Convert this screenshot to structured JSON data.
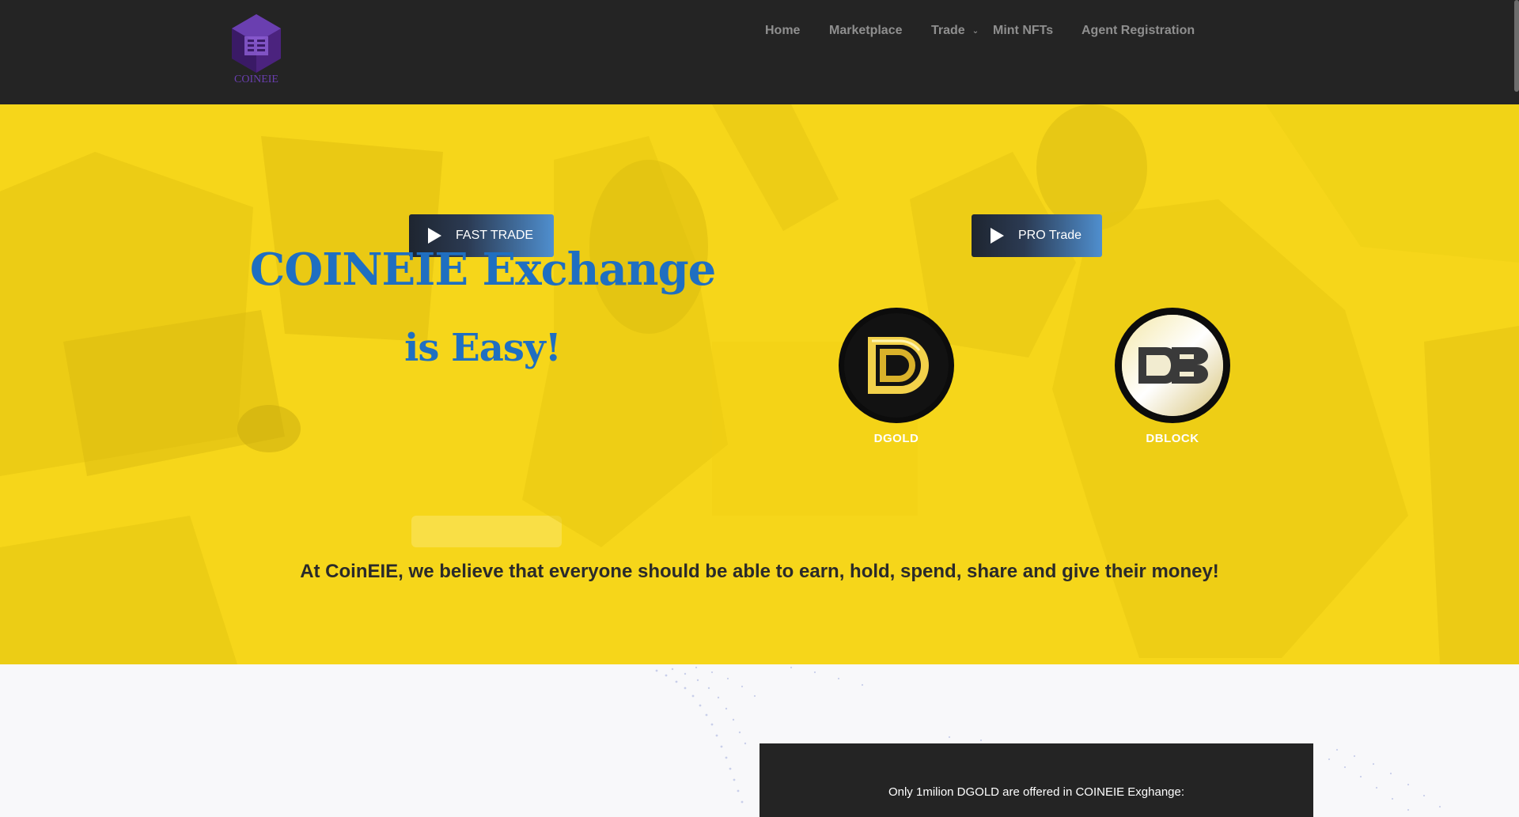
{
  "header": {
    "logo_text": "COINEIE",
    "nav": [
      {
        "label": "Home"
      },
      {
        "label": "Marketplace"
      },
      {
        "label": "Trade",
        "has_dropdown": true
      },
      {
        "label": "Mint NFTs"
      },
      {
        "label": "Agent Registration"
      }
    ]
  },
  "hero": {
    "buttons": {
      "fast_trade": "FAST TRADE",
      "pro_trade": "PRO Trade"
    },
    "title": "COINEIE Exchange",
    "subtitle": "is Easy!",
    "coins": [
      {
        "label": "DGOLD",
        "icon": "dgold-coin-icon"
      },
      {
        "label": "DBLOCK",
        "icon": "dblock-coin-icon"
      }
    ],
    "tagline": "At CoinEIE, we believe that everyone should be able to earn, hold, spend, share and give their money!"
  },
  "offer": {
    "text": "Only 1milion DGOLD are offered in COINEIE Exghange:"
  },
  "colors": {
    "header_bg": "#242424",
    "hero_bg": "#f6d61a",
    "title_blue": "#1f6fc1",
    "logo_purple": "#6a3fb0",
    "nav_text": "#8f8f8f"
  }
}
